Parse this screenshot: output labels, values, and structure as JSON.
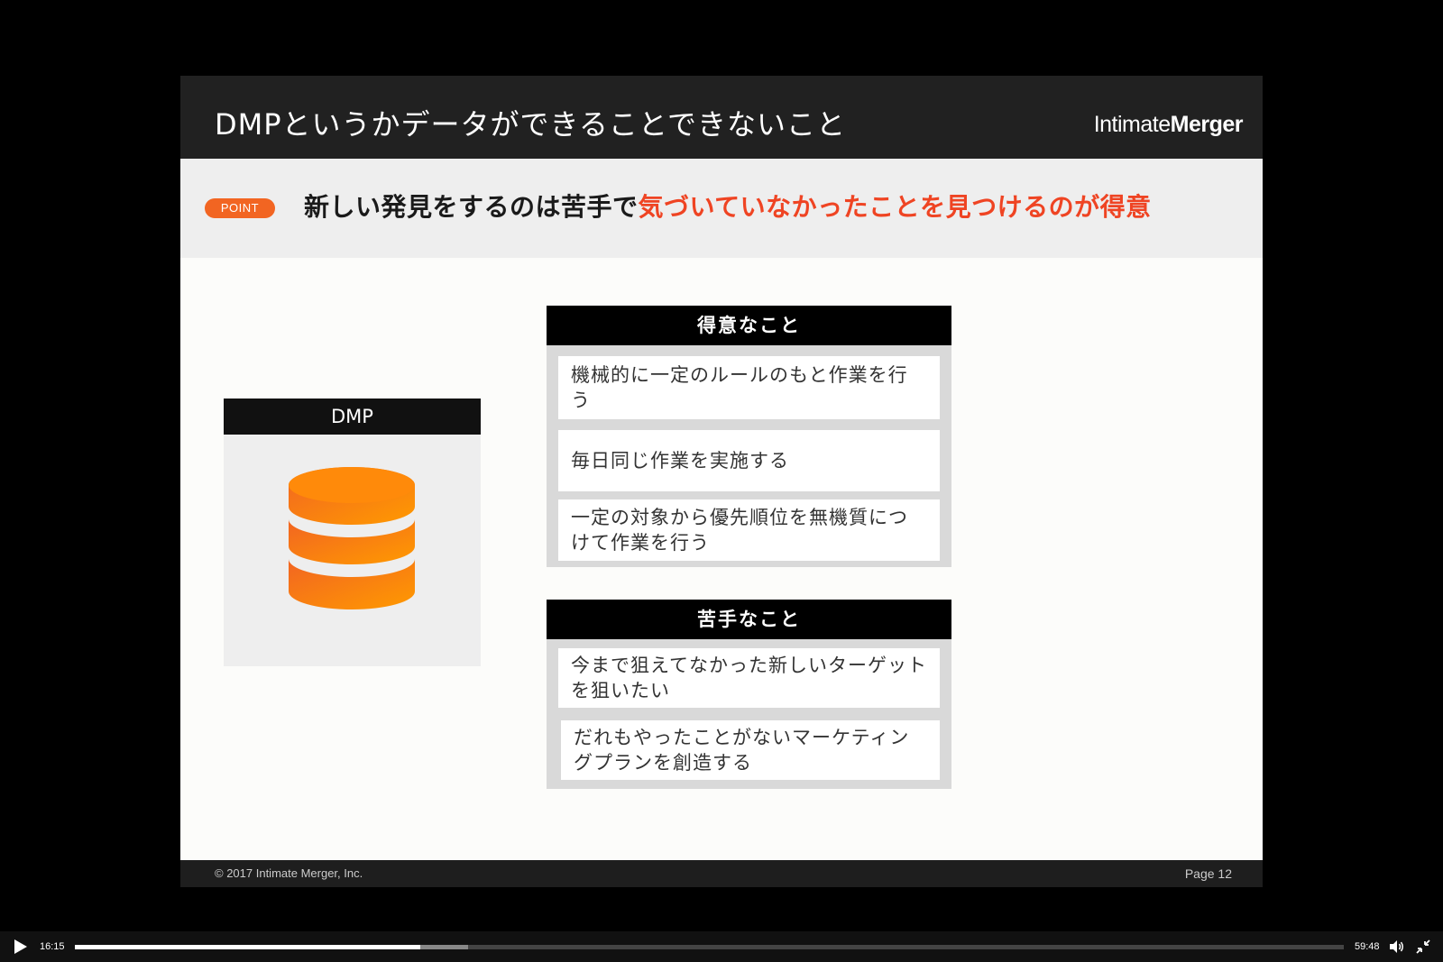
{
  "slide": {
    "title": "DMPというかデータができることできないこと",
    "brand_light": "Intimate",
    "brand_bold": "Merger",
    "point_badge": "POINT",
    "point_text_main": "新しい発見をするのは苦手で",
    "point_text_highlight": "気づいていなかったことを見つけるのが得意",
    "dmp_label": "DMP",
    "good": {
      "header": "得意なこと",
      "items": [
        "機械的に一定のルールのもと作業を行う",
        "毎日同じ作業を実施する",
        "一定の対象から優先順位を無機質につけて作業を行う"
      ]
    },
    "bad": {
      "header": "苦手なこと",
      "items": [
        "今まで狙えてなかった新しいターゲットを狙いたい",
        "だれもやったことがないマーケティングプランを創造する"
      ]
    },
    "copyright": "© 2017  Intimate Merger, Inc.",
    "page": "Page 12"
  },
  "player": {
    "current_time": "16:15",
    "duration": "59:48",
    "progress_fraction": 0.272,
    "buffered_fraction": 0.31,
    "icons": [
      "play-icon",
      "volume-icon",
      "exit-fullscreen-icon"
    ]
  },
  "colors": {
    "accent": "#ef4423",
    "badge": "#f26522",
    "header_bg": "#212121",
    "band_bg": "#eeeeee"
  }
}
